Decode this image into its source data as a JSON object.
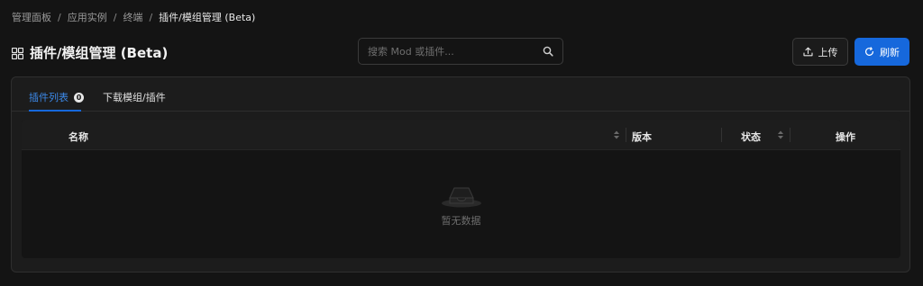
{
  "breadcrumb": {
    "items": [
      "管理面板",
      "应用实例",
      "终端",
      "插件/模组管理 (Beta)"
    ],
    "separator": "/"
  },
  "page": {
    "title": "插件/模组管理 (Beta)",
    "icon": "grid-icon"
  },
  "search": {
    "placeholder": "搜索 Mod 或插件...",
    "value": "",
    "icon": "search-icon"
  },
  "toolbar": {
    "upload_label": "上传",
    "upload_icon": "upload-icon",
    "refresh_label": "刷新",
    "refresh_icon": "refresh-icon"
  },
  "tabs": [
    {
      "label": "插件列表",
      "count": "0",
      "active": true
    },
    {
      "label": "下载模组/插件",
      "active": false
    }
  ],
  "table": {
    "columns": [
      {
        "label": "名称",
        "sortable": true
      },
      {
        "label": "版本",
        "sortable": false
      },
      {
        "label": "状态",
        "sortable": true
      },
      {
        "label": "操作",
        "sortable": false
      }
    ],
    "rows": [],
    "empty_text": "暂无数据",
    "empty_icon": "empty-inbox-icon"
  },
  "colors": {
    "accent": "#1668dc",
    "background": "#141414",
    "card": "#1c1c1c"
  }
}
